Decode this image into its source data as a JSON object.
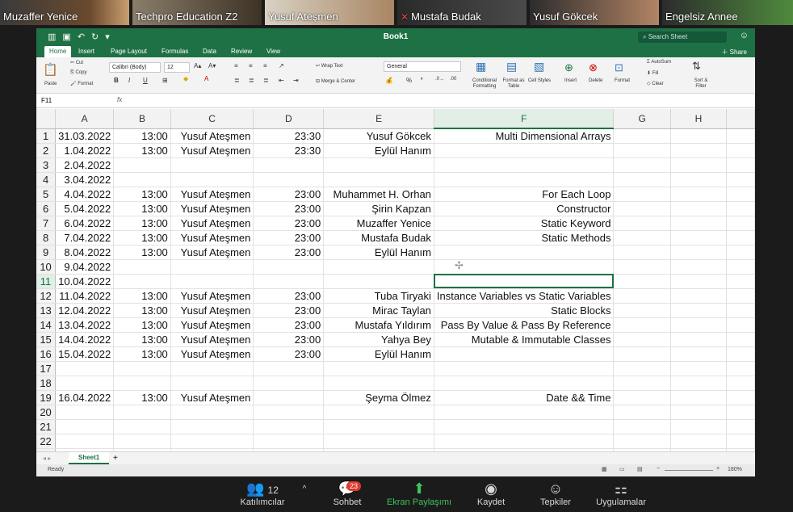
{
  "participants": [
    {
      "name": "Muzaffer Yenice",
      "muted": false,
      "active": false
    },
    {
      "name": "Techpro Education Z2",
      "muted": false,
      "active": false
    },
    {
      "name": "Yusuf Ateşmen",
      "muted": false,
      "active": true
    },
    {
      "name": "Mustafa Budak",
      "muted": true,
      "active": false
    },
    {
      "name": "Yusuf Gökcek",
      "muted": false,
      "active": false
    },
    {
      "name": "Engelsiz Annee",
      "muted": false,
      "active": false
    }
  ],
  "excel": {
    "title": "Book1",
    "search_placeholder": "Search Sheet",
    "tabs": [
      "Home",
      "Insert",
      "Page Layout",
      "Formulas",
      "Data",
      "Review",
      "View"
    ],
    "share_label": "Share",
    "ribbon": {
      "paste": "Paste",
      "cut": "Cut",
      "copy": "Copy",
      "format": "Format",
      "font": "Calibri (Body)",
      "font_size": "12",
      "wrap": "Wrap Text",
      "merge": "Merge & Center",
      "number_format": "General",
      "cond_fmt": "Conditional Formatting",
      "fmt_table": "Format as Table",
      "cell_styles": "Cell Styles",
      "insert": "Insert",
      "delete": "Delete",
      "format2": "Format",
      "autosum": "AutoSum",
      "fill": "Fill",
      "clear": "Clear",
      "sort": "Sort & Filter"
    },
    "name_box": "F11",
    "fx": "fx",
    "columns": [
      "A",
      "B",
      "C",
      "D",
      "E",
      "F",
      "G",
      "H"
    ],
    "selected_col": "F",
    "selected_row": 11,
    "rows": [
      {
        "n": "1",
        "a": "31.03.2022",
        "b": "13:00",
        "c": "Yusuf Ateşmen",
        "d": "23:30",
        "e": "Yusuf Gökcek",
        "f": "Multi Dimensional Arrays"
      },
      {
        "n": "2",
        "a": "1.04.2022",
        "b": "13:00",
        "c": "Yusuf Ateşmen",
        "d": "23:30",
        "e": "Eylül Hanım",
        "f": ""
      },
      {
        "n": "3",
        "a": "2.04.2022",
        "b": "",
        "c": "",
        "d": "",
        "e": "",
        "f": ""
      },
      {
        "n": "4",
        "a": "3.04.2022",
        "b": "",
        "c": "",
        "d": "",
        "e": "",
        "f": ""
      },
      {
        "n": "5",
        "a": "4.04.2022",
        "b": "13:00",
        "c": "Yusuf Ateşmen",
        "d": "23:00",
        "e": "Muhammet H. Orhan",
        "f": "For Each Loop"
      },
      {
        "n": "6",
        "a": "5.04.2022",
        "b": "13:00",
        "c": "Yusuf Ateşmen",
        "d": "23:00",
        "e": "Şirin Kapzan",
        "f": "Constructor"
      },
      {
        "n": "7",
        "a": "6.04.2022",
        "b": "13:00",
        "c": "Yusuf Ateşmen",
        "d": "23:00",
        "e": "Muzaffer Yenice",
        "f": "Static Keyword"
      },
      {
        "n": "8",
        "a": "7.04.2022",
        "b": "13:00",
        "c": "Yusuf Ateşmen",
        "d": "23:00",
        "e": "Mustafa Budak",
        "f": "Static Methods"
      },
      {
        "n": "9",
        "a": "8.04.2022",
        "b": "13:00",
        "c": "Yusuf Ateşmen",
        "d": "23:00",
        "e": "Eylül Hanım",
        "f": ""
      },
      {
        "n": "10",
        "a": "9.04.2022",
        "b": "",
        "c": "",
        "d": "",
        "e": "",
        "f": ""
      },
      {
        "n": "11",
        "a": "10.04.2022",
        "b": "",
        "c": "",
        "d": "",
        "e": "",
        "f": ""
      },
      {
        "n": "12",
        "a": "11.04.2022",
        "b": "13:00",
        "c": "Yusuf Ateşmen",
        "d": "23:00",
        "e": "Tuba Tiryaki",
        "f": "Instance Variables vs Static Variables"
      },
      {
        "n": "13",
        "a": "12.04.2022",
        "b": "13:00",
        "c": "Yusuf Ateşmen",
        "d": "23:00",
        "e": "Mirac Taylan",
        "f": "Static Blocks"
      },
      {
        "n": "14",
        "a": "13.04.2022",
        "b": "13:00",
        "c": "Yusuf Ateşmen",
        "d": "23:00",
        "e": "Mustafa Yıldırım",
        "f": "Pass By Value & Pass By Reference"
      },
      {
        "n": "15",
        "a": "14.04.2022",
        "b": "13:00",
        "c": "Yusuf Ateşmen",
        "d": "23:00",
        "e": "Yahya Bey",
        "f": "Mutable & Immutable Classes"
      },
      {
        "n": "16",
        "a": "15.04.2022",
        "b": "13:00",
        "c": "Yusuf Ateşmen",
        "d": "23:00",
        "e": "Eylül Hanım",
        "f": ""
      },
      {
        "n": "17",
        "a": "",
        "b": "",
        "c": "",
        "d": "",
        "e": "",
        "f": ""
      },
      {
        "n": "18",
        "a": "",
        "b": "",
        "c": "",
        "d": "",
        "e": "",
        "f": ""
      },
      {
        "n": "19",
        "a": "16.04.2022",
        "b": "13:00",
        "c": "Yusuf Ateşmen",
        "d": "",
        "e": "Şeyma Ölmez",
        "f": "Date && Time"
      },
      {
        "n": "20",
        "a": "",
        "b": "",
        "c": "",
        "d": "",
        "e": "",
        "f": ""
      },
      {
        "n": "21",
        "a": "",
        "b": "",
        "c": "",
        "d": "",
        "e": "",
        "f": ""
      },
      {
        "n": "22",
        "a": "",
        "b": "",
        "c": "",
        "d": "",
        "e": "",
        "f": ""
      },
      {
        "n": "23",
        "a": "",
        "b": "",
        "c": "",
        "d": "",
        "e": "",
        "f": ""
      }
    ],
    "sheet_tab": "Sheet1",
    "status": "Ready",
    "zoom": "180%"
  },
  "zoom_toolbar": {
    "participants_count": "12",
    "participants": "Katılımcılar",
    "chat": "Sohbet",
    "chat_badge": "23",
    "share": "Ekran Paylaşımı",
    "record": "Kaydet",
    "reactions": "Tepkiler",
    "apps": "Uygulamalar"
  },
  "colors": {
    "excel_green": "#1e7145",
    "share_green": "#3fc35a",
    "badge_red": "#e0392f"
  }
}
